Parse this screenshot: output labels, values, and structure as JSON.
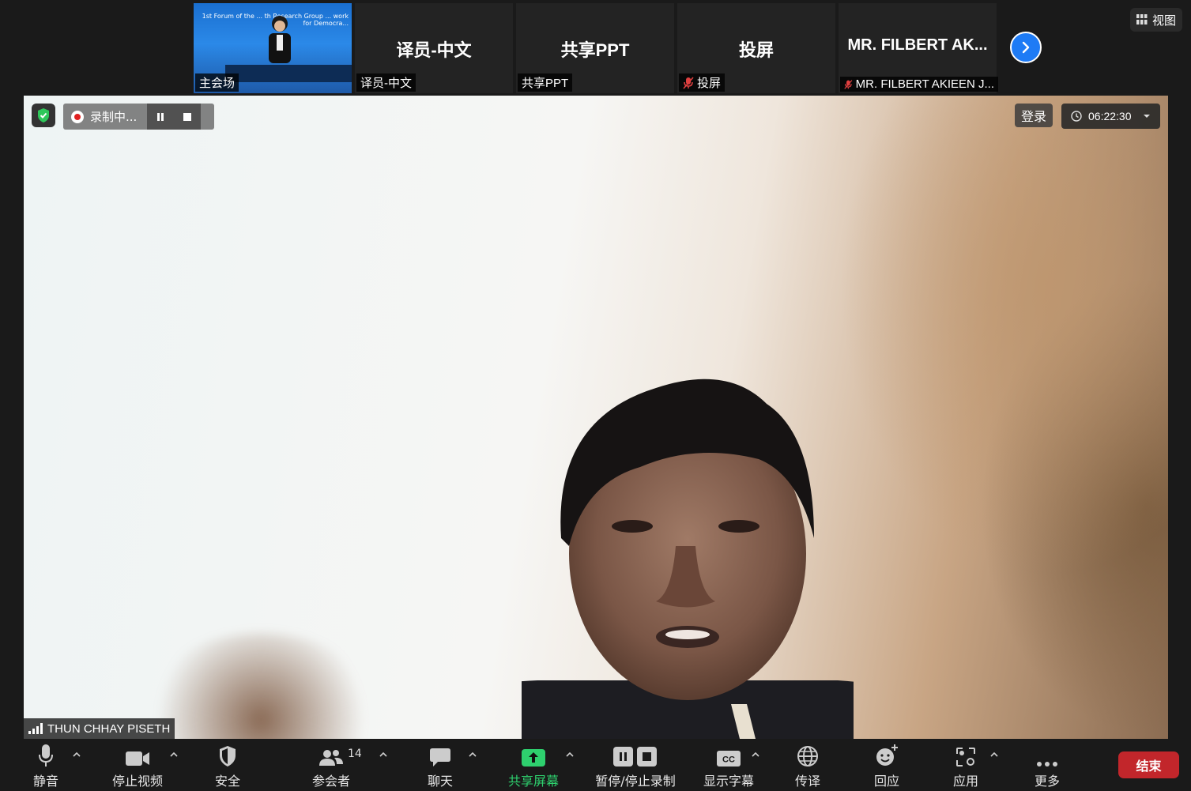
{
  "gallery": {
    "tiles": [
      {
        "caption": "主会场",
        "muted": false
      },
      {
        "name": "译员-中文",
        "caption": "译员-中文",
        "muted": false
      },
      {
        "name": "共享PPT",
        "caption": "共享PPT",
        "muted": false
      },
      {
        "name": "投屏",
        "caption": "投屏",
        "muted": true
      },
      {
        "name": "MR. FILBERT AK...",
        "caption": "MR. FILBERT AKIEEN J...",
        "muted": true
      }
    ],
    "video_banner_text": "1st Forum of the ... th Research Group ... work for Democra...",
    "view_label": "视图"
  },
  "stage": {
    "recording_label": "录制中...",
    "login_label": "登录",
    "timer": "06:22:30",
    "speaker_name": "THUN CHHAY PISETH"
  },
  "toolbar": {
    "mute": "静音",
    "stop_video": "停止视频",
    "security": "安全",
    "participants": "参会者",
    "participant_count": "14",
    "chat": "聊天",
    "share_screen": "共享屏幕",
    "pause_stop_recording": "暂停/停止录制",
    "captions": "显示字幕",
    "interpretation": "传译",
    "reactions": "回应",
    "apps": "应用",
    "more": "更多",
    "end": "结束"
  },
  "colors": {
    "accent_green": "#2ed06e",
    "end_red": "#c2262b",
    "next_blue": "#1e7bf5",
    "mute_red": "#e04040"
  }
}
